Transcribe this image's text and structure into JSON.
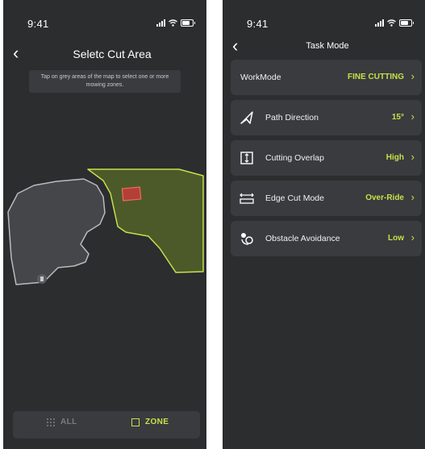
{
  "left_screen": {
    "status": {
      "time": "9:41"
    },
    "title": "Seletc Cut Area",
    "hint": "Tap on grey areas of the map to select one or more mowing zones.",
    "tabs": {
      "all_label": "ALL",
      "zone_label": "ZONE",
      "selected": "ZONE"
    }
  },
  "right_screen": {
    "status": {
      "time": "9:41"
    },
    "title": "Task Mode",
    "settings": [
      {
        "label": "WorkMode",
        "value": "FINE CUTTING",
        "icon": null
      },
      {
        "label": "Path Direction",
        "value": "15°",
        "icon": "navigation-arrow-icon"
      },
      {
        "label": "Cutting Overlap",
        "value": "High",
        "icon": "overlap-icon"
      },
      {
        "label": "Edge Cut Mode",
        "value": "Over-Ride",
        "icon": "edge-cut-icon"
      },
      {
        "label": "Obstacle Avoidance",
        "value": "Low",
        "icon": "obstacle-icon"
      }
    ]
  },
  "colors": {
    "background": "#2b2d2f",
    "card": "#393b3e",
    "accent": "#c8e04a",
    "selected_zone_fill": "#4c5a2a",
    "unselected_zone_fill": "#444649",
    "highlight_marker": "#d9534f"
  }
}
